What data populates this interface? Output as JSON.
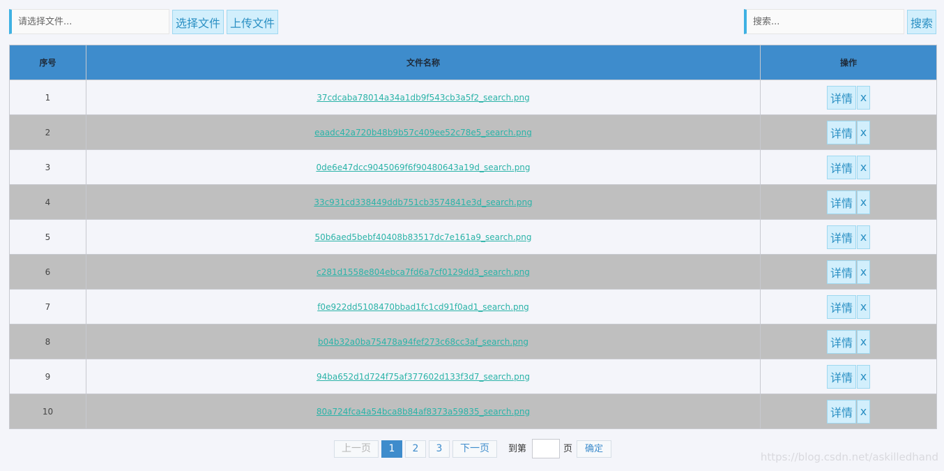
{
  "toolbar": {
    "file_placeholder": "请选择文件...",
    "select_label": "选择文件",
    "upload_label": "上传文件",
    "search_placeholder": "搜索...",
    "search_label": "搜索"
  },
  "table": {
    "headers": [
      "序号",
      "文件名称",
      "操作"
    ],
    "detail_label": "详情",
    "delete_label": "x",
    "rows": [
      {
        "idx": "1",
        "name": "37cdcaba78014a34a1db9f543cb3a5f2_search.png"
      },
      {
        "idx": "2",
        "name": "eaadc42a720b48b9b57c409ee52c78e5_search.png"
      },
      {
        "idx": "3",
        "name": "0de6e47dcc9045069f6f90480643a19d_search.png"
      },
      {
        "idx": "4",
        "name": "33c931cd338449ddb751cb3574841e3d_search.png"
      },
      {
        "idx": "5",
        "name": "50b6aed5bebf40408b83517dc7e161a9_search.png"
      },
      {
        "idx": "6",
        "name": "c281d1558e804ebca7fd6a7cf0129dd3_search.png"
      },
      {
        "idx": "7",
        "name": "f0e922dd5108470bbad1fc1cd91f0ad1_search.png"
      },
      {
        "idx": "8",
        "name": "b04b32a0ba75478a94fef273c68cc3af_search.png"
      },
      {
        "idx": "9",
        "name": "94ba652d1d724f75af377602d133f3d7_search.png"
      },
      {
        "idx": "10",
        "name": "80a724fca4a54bca8b84af8373a59835_search.png"
      }
    ]
  },
  "pager": {
    "prev_label": "上一页",
    "pages": [
      "1",
      "2",
      "3"
    ],
    "next_label": "下一页",
    "goto_label": "到第",
    "page_label": "页",
    "confirm_label": "确定"
  },
  "colors": {
    "header_bg": "#3e8ccc",
    "row_alt_bg": "#bfbfbf",
    "link_color": "#2bb3a8",
    "accent_border": "#3fb1e3",
    "button_bg": "#d2effc"
  },
  "watermark": "https://blog.csdn.net/askilledhand"
}
